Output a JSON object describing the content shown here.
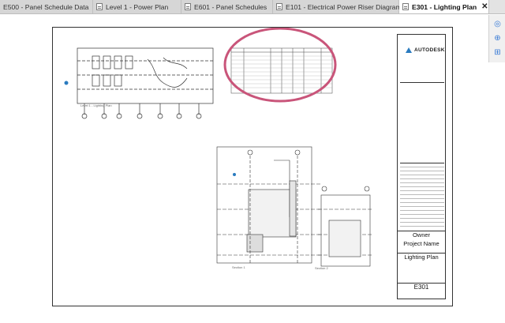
{
  "tabs": [
    {
      "label": "E500 - Panel Schedule Data"
    },
    {
      "label": "Level 1 - Power Plan"
    },
    {
      "label": "E601 - Panel Schedules"
    },
    {
      "label": "E101 - Electrical Power Riser Diagram"
    },
    {
      "label": "E301 - Lighting Plan"
    }
  ],
  "active_tab_close": "✕",
  "sheet": {
    "logo_text": "AUTODESK",
    "owner": "Owner",
    "project_name": "Project Name",
    "sheet_name": "Lighting Plan",
    "sheet_number": "E301",
    "view_label_plan": "Level 1 - Lighting Plan",
    "view_label_section1": "Section 1",
    "view_label_section2": "Section 2"
  },
  "colors": {
    "highlight": "#c9557a",
    "accent": "#2a7bbf"
  }
}
